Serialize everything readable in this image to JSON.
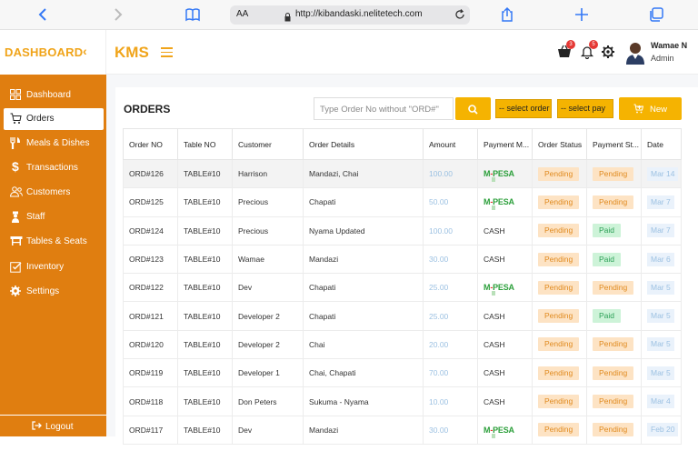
{
  "browser": {
    "text_size_label": "AA",
    "url": "http://kibandaski.nelitetech.com"
  },
  "sidebar": {
    "title": "DASHBOARD",
    "items": [
      {
        "label": "Dashboard",
        "icon": "grid-icon"
      },
      {
        "label": "Orders",
        "icon": "cart-icon",
        "active": true
      },
      {
        "label": "Meals & Dishes",
        "icon": "utensils-icon"
      },
      {
        "label": "Transactions",
        "icon": "dollar-icon"
      },
      {
        "label": "Customers",
        "icon": "users-icon"
      },
      {
        "label": "Staff",
        "icon": "staff-icon"
      },
      {
        "label": "Tables & Seats",
        "icon": "table-icon"
      },
      {
        "label": "Inventory",
        "icon": "inventory-icon"
      },
      {
        "label": "Settings",
        "icon": "gear-icon"
      }
    ],
    "logout_label": "Logout"
  },
  "topbar": {
    "brand": "KMS",
    "cart_badge": "3",
    "bell_badge": "5",
    "user_name": "Wamae N",
    "user_role": "Admin"
  },
  "orders": {
    "title": "ORDERS",
    "search_placeholder": "Type Order No without \"ORD#\"",
    "filter1": "-- select order",
    "filter2": "-- select pay",
    "new_label": "New",
    "columns": [
      "Order NO",
      "Table NO",
      "Customer",
      "Order Details",
      "Amount",
      "Payment M...",
      "Order Status",
      "Payment St...",
      "Date"
    ],
    "rows": [
      {
        "order_no": "ORD#126",
        "table_no": "TABLE#10",
        "customer": "Harrison",
        "details": "Mandazi, Chai",
        "amount": "100.00",
        "payment_method": "MPESA",
        "order_status": "Pending",
        "payment_status": "Pending",
        "date": "Mar 14"
      },
      {
        "order_no": "ORD#125",
        "table_no": "TABLE#10",
        "customer": "Precious",
        "details": "Chapati",
        "amount": "50.00",
        "payment_method": "MPESA",
        "order_status": "Pending",
        "payment_status": "Pending",
        "date": "Mar 7"
      },
      {
        "order_no": "ORD#124",
        "table_no": "TABLE#10",
        "customer": "Precious",
        "details": "Nyama Updated",
        "amount": "100.00",
        "payment_method": "CASH",
        "order_status": "Pending",
        "payment_status": "Paid",
        "date": "Mar 7"
      },
      {
        "order_no": "ORD#123",
        "table_no": "TABLE#10",
        "customer": "Wamae",
        "details": "Mandazi",
        "amount": "30.00",
        "payment_method": "CASH",
        "order_status": "Pending",
        "payment_status": "Paid",
        "date": "Mar 6"
      },
      {
        "order_no": "ORD#122",
        "table_no": "TABLE#10",
        "customer": "Dev",
        "details": "Chapati",
        "amount": "25.00",
        "payment_method": "MPESA",
        "order_status": "Pending",
        "payment_status": "Pending",
        "date": "Mar 5"
      },
      {
        "order_no": "ORD#121",
        "table_no": "TABLE#10",
        "customer": "Developer 2",
        "details": "Chapati",
        "amount": "25.00",
        "payment_method": "CASH",
        "order_status": "Pending",
        "payment_status": "Paid",
        "date": "Mar 5"
      },
      {
        "order_no": "ORD#120",
        "table_no": "TABLE#10",
        "customer": "Developer 2",
        "details": "Chai",
        "amount": "20.00",
        "payment_method": "CASH",
        "order_status": "Pending",
        "payment_status": "Pending",
        "date": "Mar 5"
      },
      {
        "order_no": "ORD#119",
        "table_no": "TABLE#10",
        "customer": "Developer 1",
        "details": "Chai, Chapati",
        "amount": "70.00",
        "payment_method": "CASH",
        "order_status": "Pending",
        "payment_status": "Pending",
        "date": "Mar 5"
      },
      {
        "order_no": "ORD#118",
        "table_no": "TABLE#10",
        "customer": "Don Peters",
        "details": "Sukuma - Nyama",
        "amount": "10.00",
        "payment_method": "CASH",
        "order_status": "Pending",
        "payment_status": "Pending",
        "date": "Mar 4"
      },
      {
        "order_no": "ORD#117",
        "table_no": "TABLE#10",
        "customer": "Dev",
        "details": "Mandazi",
        "amount": "30.00",
        "payment_method": "MPESA",
        "order_status": "Pending",
        "payment_status": "Pending",
        "date": "Feb 20"
      }
    ]
  },
  "colors": {
    "sidebar": "#e07e10",
    "accent": "#f5b301",
    "pending_bg": "#fde3c4",
    "paid_bg": "#cdf3d8"
  }
}
